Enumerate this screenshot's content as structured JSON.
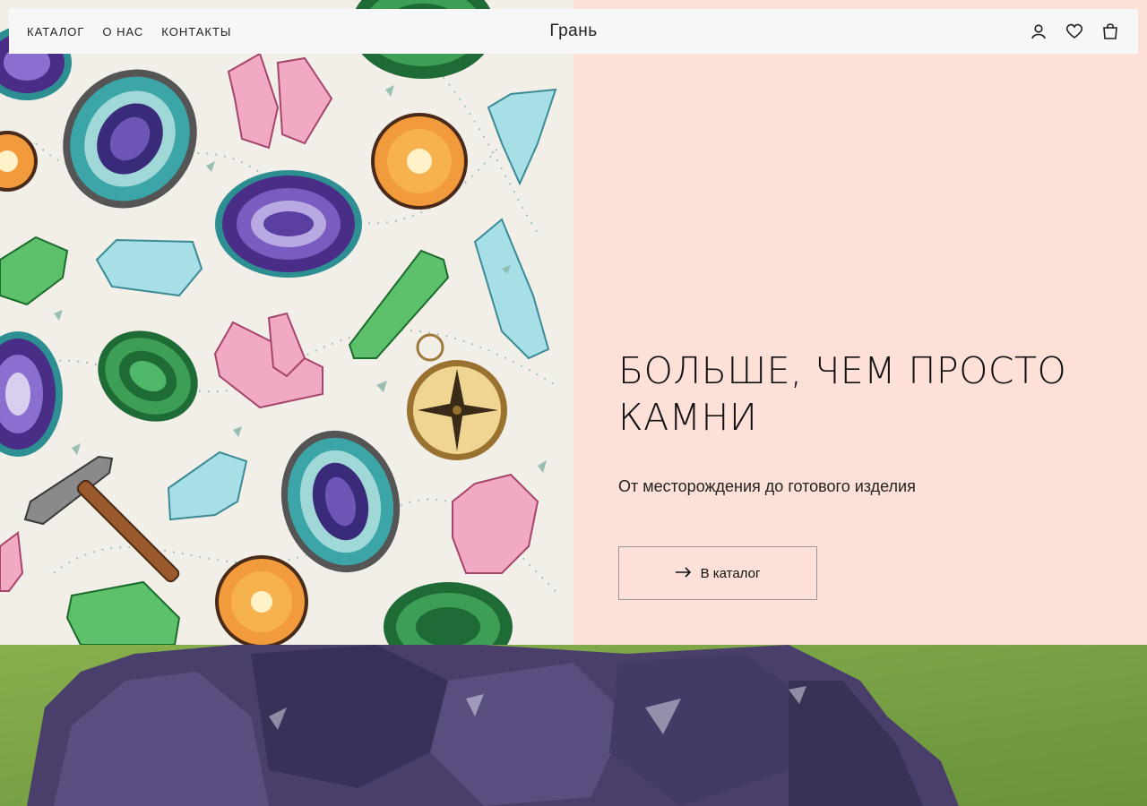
{
  "header": {
    "nav": [
      {
        "label": "КАТАЛОГ"
      },
      {
        "label": "О НАС"
      },
      {
        "label": "КОНТАКТЫ"
      }
    ],
    "brand": "Грань",
    "icons": [
      "user-icon",
      "heart-icon",
      "bag-icon"
    ]
  },
  "hero": {
    "title": "БОЛЬШЕ, ЧЕМ ПРОСТО КАМНИ",
    "subtitle": "От месторождения до готового изделия",
    "cta_label": "В каталог"
  },
  "colors": {
    "hero_right_bg": "#fde0d8",
    "header_bg": "#f7f7f7",
    "pattern_bg": "#f1efe8"
  }
}
